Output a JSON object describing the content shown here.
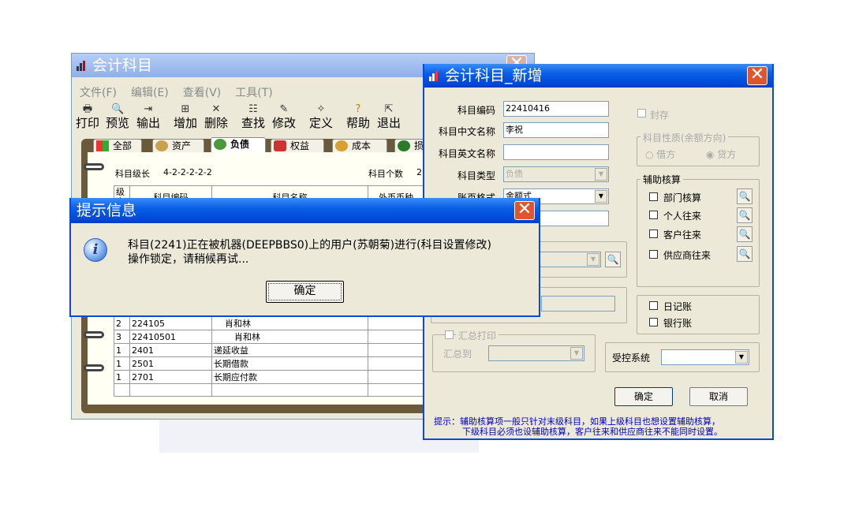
{
  "main_window": {
    "title": "会计科目",
    "menu": [
      "文件(F)",
      "编辑(E)",
      "查看(V)",
      "工具(T)"
    ],
    "toolbar": [
      "打印",
      "预览",
      "输出",
      "增加",
      "删除",
      "查找",
      "修改",
      "定义",
      "帮助",
      "退出"
    ],
    "tabs": [
      "全部",
      "资产",
      "负债",
      "权益",
      "成本",
      "损"
    ],
    "level_label": "科目级长",
    "level_value": "4-2-2-2-2-2",
    "count_label": "科目个数",
    "count_value": "2",
    "columns": [
      "级次",
      "科目编码",
      "科目名称",
      "外币币种"
    ],
    "rows": [
      {
        "level": "2",
        "code": "224105",
        "name": "肖和林"
      },
      {
        "level": "3",
        "code": "22410501",
        "name": "肖和林"
      },
      {
        "level": "1",
        "code": "2401",
        "name": "递延收益"
      },
      {
        "level": "1",
        "code": "2501",
        "name": "长期借款"
      },
      {
        "level": "1",
        "code": "2701",
        "name": "长期应付款"
      }
    ]
  },
  "new_window": {
    "title": "会计科目_新增",
    "code_label": "科目编码",
    "code_value": "22410416",
    "cn_label": "科目中文名称",
    "cn_value": "李祝",
    "en_label": "科目英文名称",
    "en_value": "",
    "type_label": "科目类型",
    "type_value": "负债",
    "format_label": "账页格式",
    "format_value": "金额式",
    "seal_label": "封存",
    "nature_title": "科目性质(余额方向)",
    "debit_label": "借方",
    "credit_label": "贷方",
    "aux_title": "辅助核算",
    "aux_items": [
      "部门核算",
      "个人往来",
      "客户往来",
      "供应商往来"
    ],
    "journal_label": "日记账",
    "bank_label": "银行账",
    "summary_print_label": "汇总打印",
    "summary_to_label": "汇总到",
    "control_label": "受控系统",
    "ok_label": "确定",
    "cancel_label": "取消",
    "hint_line1": "提示：辅助核算项一般只针对末级科目，如果上级科目也想设置辅助核算，",
    "hint_line2": "下级科目必须也设辅助核算，客户往来和供应商往来不能同时设置。"
  },
  "dialog": {
    "title": "提示信息",
    "message_line1": "科目(2241)正在被机器(DEEPBBS0)上的用户(苏朝菊)进行(科目设置修改)",
    "message_line2": "操作锁定，请稍候再试...",
    "ok_label": "确定"
  },
  "colors": {
    "titlebar": "#0a5fe6",
    "window_bg": "#ece9d8",
    "close_button": "#e0552e",
    "paper": "#fffff4"
  }
}
